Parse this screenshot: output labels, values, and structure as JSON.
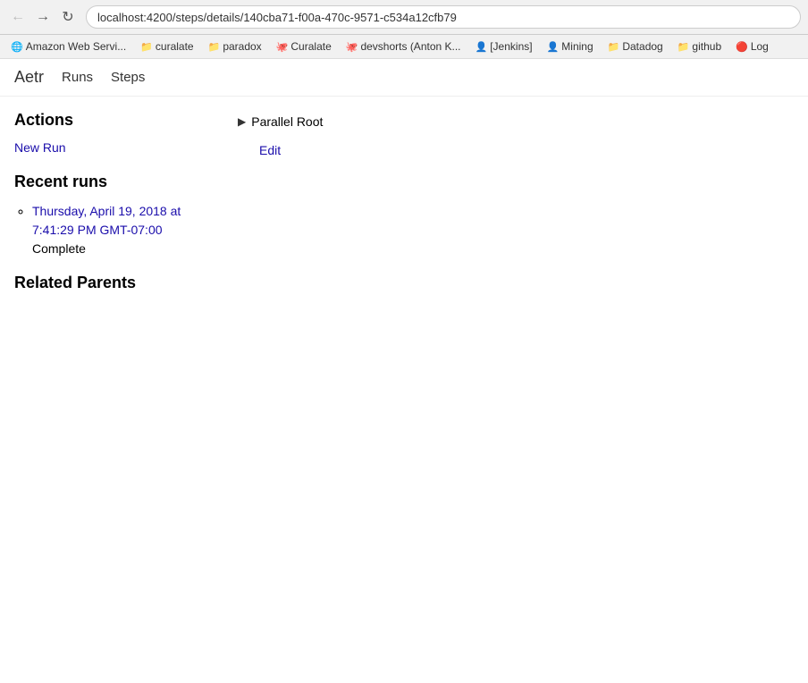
{
  "browser": {
    "url": "localhost:4200/steps/details/140cba71-f00a-470c-9571-c534a12cfb79",
    "back_disabled": false,
    "forward_disabled": false
  },
  "bookmarks": [
    {
      "label": "Amazon Web Servi...",
      "icon": "🌐"
    },
    {
      "label": "curalate",
      "icon": "📁"
    },
    {
      "label": "paradox",
      "icon": "📁"
    },
    {
      "label": "Curalate",
      "icon": "🐙"
    },
    {
      "label": "devshorts (Anton K...",
      "icon": "🐙"
    },
    {
      "label": "[Jenkins]",
      "icon": "👤"
    },
    {
      "label": "Mining",
      "icon": "👤"
    },
    {
      "label": "Datadog",
      "icon": "📁"
    },
    {
      "label": "github",
      "icon": "📁"
    },
    {
      "label": "Log",
      "icon": "🔴"
    }
  ],
  "nav": {
    "app_name": "Aetr",
    "links": [
      "Runs",
      "Steps"
    ]
  },
  "left_panel": {
    "actions_title": "Actions",
    "new_run_label": "New Run",
    "recent_runs_title": "Recent runs",
    "runs": [
      {
        "date_link": "Thursday, April 19, 2018 at 7:41:29 PM GMT-07:00",
        "status": "Complete"
      }
    ],
    "related_parents_title": "Related Parents"
  },
  "right_panel": {
    "parallel_root_label": "Parallel Root",
    "triangle": "▶",
    "edit_label": "Edit"
  }
}
